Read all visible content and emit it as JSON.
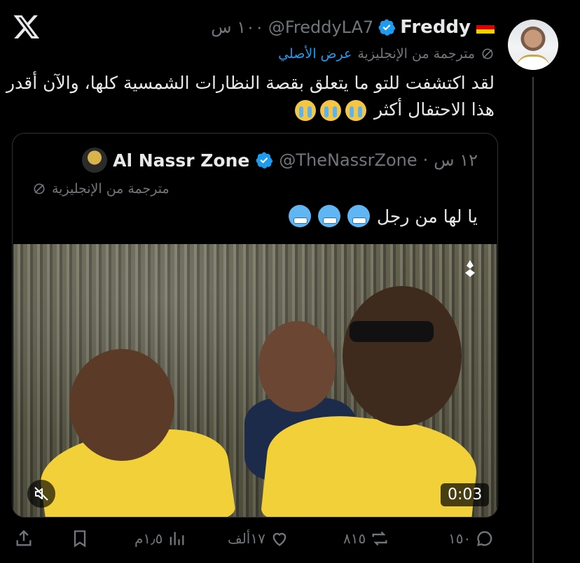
{
  "author": {
    "name": "Freddy",
    "handle": "@FreddyLA7",
    "time": "١٠٠ س",
    "flag": "germany-flag"
  },
  "translation": {
    "label": "مترجمة من الإنجليزية",
    "show_original": "عرض الأصلي"
  },
  "tweet": {
    "text": "لقد اكتشفت للتو ما يتعلق بقصة النظارات الشمسية كلها، والآن أقدر هذا الاحتفال أكثر"
  },
  "quote": {
    "name": "Al Nassr Zone",
    "handle": "@TheNassrZone",
    "time": "١٢ س",
    "translated_label": "مترجمة من الإنجليزية",
    "text": "يا لها من رجل",
    "video_duration": "0:03"
  },
  "actions": {
    "replies": "١٥٠",
    "reposts": "٨١٥",
    "likes": "١٧ألف",
    "views": "١٫٥م"
  },
  "colors": {
    "background": "#000000",
    "text": "#e7e9ea",
    "muted": "#71767b",
    "accent": "#1d9bf0"
  }
}
